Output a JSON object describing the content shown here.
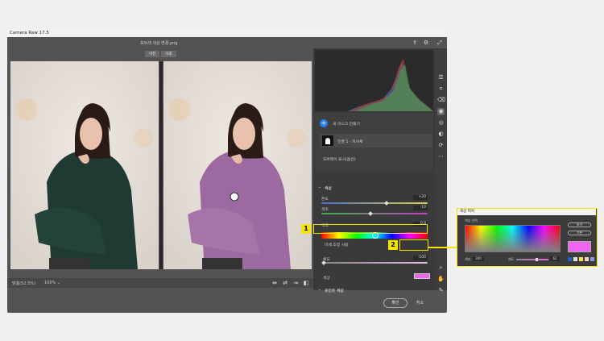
{
  "window": {
    "title": "Camera Raw 17.5",
    "filename": "포트레 색상 변경.png",
    "view_tabs": [
      "이전",
      "이후"
    ],
    "zoom_label": "맞춤(52.5%)",
    "zoom_select": "100%",
    "ok_label": "확인",
    "cancel_label": "취소"
  },
  "panel": {
    "mask_create": "새 마스크 만들기",
    "mask_item": "전경 1 - 피사체",
    "overlay_label": "오버레이 표시(옵션)",
    "color_section": "색상",
    "temp_label": "온도",
    "temp_value": "+20",
    "tint_label": "색조",
    "tint_value": "-10",
    "hue_label": "색조",
    "hue_value": "0.0",
    "fine_adjust": "미세 조정 사용",
    "sat_label": "채도",
    "sat_value": "-100",
    "color_label": "색상",
    "color_value": "#ee66ee",
    "point_color": "포인트 색상"
  },
  "callouts": [
    "1",
    "2"
  ],
  "picker": {
    "title": "색상 피커",
    "subtitle": "색상 선택",
    "hue_label": "색조",
    "hue_value": "300",
    "sat_label": "채도",
    "sat_value": "62",
    "btn_reset": "초기",
    "btn_cancel": "기본",
    "swatch_color": "#ee66ee"
  },
  "colors": {
    "accent": "#f5e300",
    "sweater_before": "#1f3a33",
    "sweater_after": "#9c6aa0"
  }
}
